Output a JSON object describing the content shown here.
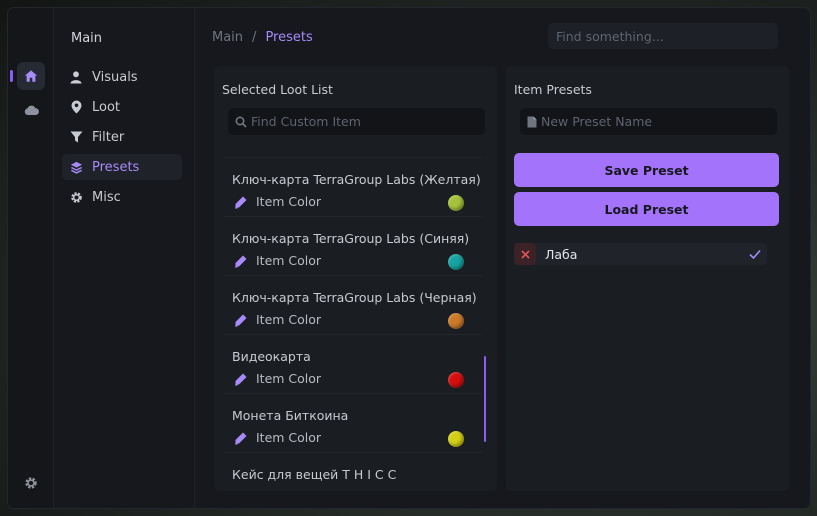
{
  "sidebar": {
    "title": "Main",
    "items": [
      {
        "label": "Visuals",
        "icon": "user-icon"
      },
      {
        "label": "Loot",
        "icon": "map-pin-icon"
      },
      {
        "label": "Filter",
        "icon": "filter-icon"
      },
      {
        "label": "Presets",
        "icon": "layers-icon",
        "active": true
      },
      {
        "label": "Misc",
        "icon": "gear-icon"
      }
    ]
  },
  "header": {
    "breadcrumb_root": "Main",
    "breadcrumb_sep": "/",
    "breadcrumb_current": "Presets",
    "search_placeholder": "Find something..."
  },
  "loot_panel": {
    "title": "Selected Loot List",
    "search_placeholder": "Find Custom Item",
    "color_label": "Item Color",
    "items": [
      {
        "name": "Ключ-карта TerraGroup Labs (Желтая)",
        "color": "#a6c23a"
      },
      {
        "name": "Ключ-карта TerraGroup Labs (Синяя)",
        "color": "#17a3a3"
      },
      {
        "name": "Ключ-карта TerraGroup Labs (Черная)",
        "color": "#cc7a2a"
      },
      {
        "name": "Видеокарта",
        "color": "#d50f0f"
      },
      {
        "name": "Монета Биткоина",
        "color": "#d4d017"
      },
      {
        "name": "Кейс для вещей T H I C C",
        "color": null
      }
    ]
  },
  "presets_panel": {
    "title": "Item Presets",
    "name_placeholder": "New Preset Name",
    "save_label": "Save Preset",
    "load_label": "Load Preset",
    "presets": [
      {
        "name": "Лаба",
        "selected": true
      }
    ]
  },
  "colors": {
    "accent": "#a374fb",
    "accent_text": "#a78bfa"
  }
}
